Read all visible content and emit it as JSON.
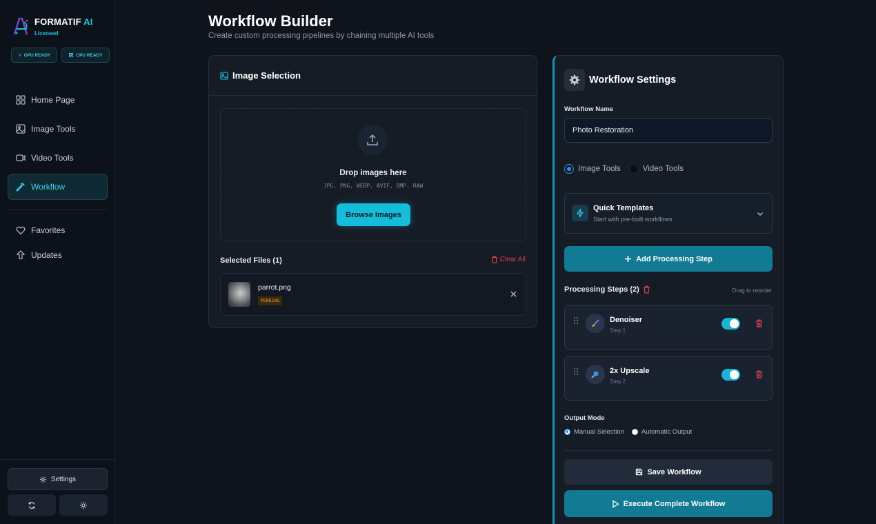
{
  "app": {
    "brand_name": "FORMATIF",
    "brand_ai": "AI",
    "license": "Licensed",
    "badges": [
      {
        "label": "GPU READY",
        "icon": "bolt-icon"
      },
      {
        "label": "CPU READY",
        "icon": "chip-icon"
      }
    ]
  },
  "sidebar": {
    "items": [
      {
        "label": "Home Page",
        "icon": "grid-icon",
        "active": false
      },
      {
        "label": "Image Tools",
        "icon": "image-icon",
        "active": false
      },
      {
        "label": "Video Tools",
        "icon": "video-icon",
        "active": false
      },
      {
        "label": "Workflow",
        "icon": "wrench-icon",
        "active": true
      }
    ],
    "secondary": [
      {
        "label": "Favorites",
        "icon": "heart-icon"
      },
      {
        "label": "Updates",
        "icon": "upload-arrow-icon"
      }
    ],
    "settings_label": "Settings"
  },
  "header": {
    "title": "Workflow Builder",
    "subtitle": "Create custom processing pipelines by chaining multiple AI tools"
  },
  "image_selection": {
    "title": "Image Selection",
    "drop_title": "Drop images here",
    "formats": "JPG, PNG, WEBP, AVIF, BMP, RAW",
    "browse_label": "Browse Images",
    "selected_label": "Selected Files (1)",
    "clear_all": "Clear All",
    "files": [
      {
        "name": "parrot.png",
        "status": "PENDING"
      }
    ]
  },
  "workflow_settings": {
    "title": "Workflow Settings",
    "name_label": "Workflow Name",
    "name_value": "Photo Restoration",
    "tool_types": [
      {
        "label": "Image Tools",
        "selected": true
      },
      {
        "label": "Video Tools",
        "selected": false
      }
    ],
    "quick_templates": {
      "title": "Quick Templates",
      "subtitle": "Start with pre-built workflows"
    },
    "add_step_label": "Add Processing Step",
    "steps_label": "Processing Steps (2)",
    "drag_hint": "Drag to reorder",
    "steps": [
      {
        "name": "Denoiser",
        "sub": "Step 1",
        "enabled": true,
        "icon": "brush-icon"
      },
      {
        "name": "2x Upscale",
        "sub": "Step 2",
        "enabled": true,
        "icon": "magnify-icon"
      }
    ],
    "output_mode_label": "Output Mode",
    "output_modes": [
      {
        "label": "Manual Selection",
        "selected": true
      },
      {
        "label": "Automatic Output",
        "selected": false
      }
    ],
    "save_label": "Save Workflow",
    "execute_label": "Execute Complete Workflow"
  },
  "colors": {
    "accent": "#14bdd9",
    "primary_button": "#137a94",
    "danger": "#e0424a",
    "pending": "#f0a23a",
    "background": "#0e131c"
  }
}
